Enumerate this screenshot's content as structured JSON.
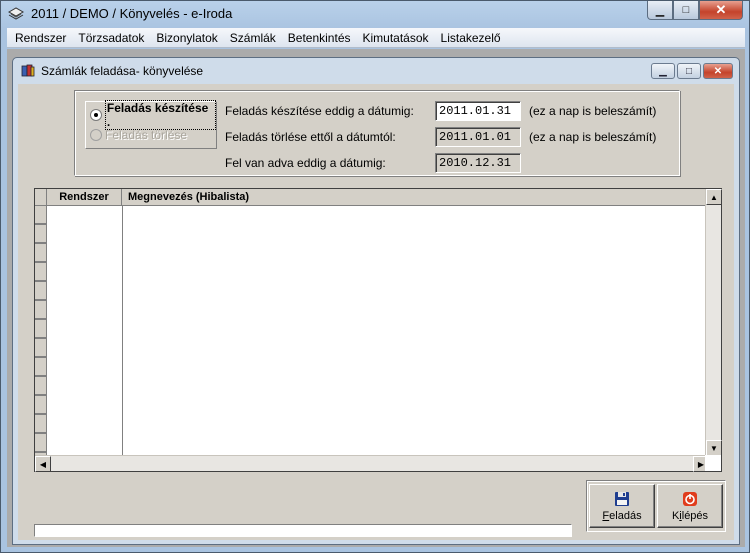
{
  "window": {
    "title": "2011 / DEMO / Könyvelés - e-Iroda",
    "minimize_glyph": "▁",
    "maximize_glyph": "□",
    "close_glyph": "✕"
  },
  "menu": [
    {
      "label": "Rendszer"
    },
    {
      "label": "Törzsadatok"
    },
    {
      "label": "Bizonylatok"
    },
    {
      "label": "Számlák"
    },
    {
      "label": "Betenkintés"
    },
    {
      "label": "Kimutatások"
    },
    {
      "label": "Listakezelő"
    }
  ],
  "child_window": {
    "title": "Számlák feladása- könyvelése",
    "minimize_glyph": "▁",
    "maximize_glyph": "□",
    "close_glyph": "✕"
  },
  "options": {
    "radio_create": {
      "label": "Feladás készítése .",
      "checked": true
    },
    "radio_delete": {
      "label": "Feladás törlése",
      "checked": false,
      "disabled": true
    },
    "fields": [
      {
        "label": "Feladás készítése eddig a dátumig:",
        "value": "2011.01.31",
        "note": "(ez a nap is beleszámít)",
        "editable": true
      },
      {
        "label": "Feladás törlése ettől a dátumtól:",
        "value": "2011.01.01",
        "note": "(ez a nap is beleszámít)",
        "editable": false
      },
      {
        "label": "Fel van adva eddig a dátumig:",
        "value": "2010.12.31",
        "note": "",
        "editable": false
      }
    ]
  },
  "grid": {
    "columns": [
      {
        "header": "Rendszer"
      },
      {
        "header": "Megnevezés (Hibalista)"
      }
    ],
    "rows": []
  },
  "buttons": {
    "submit": {
      "label_underlined": "F",
      "label_rest": "eladás",
      "icon": "floppy-disk-icon"
    },
    "exit": {
      "label_prefix": "K",
      "label_underlined": "i",
      "label_rest": "lépés",
      "icon": "power-icon"
    }
  },
  "colors": {
    "accent_exit": "#e03c1c",
    "floppy": "#1e3d8f"
  }
}
